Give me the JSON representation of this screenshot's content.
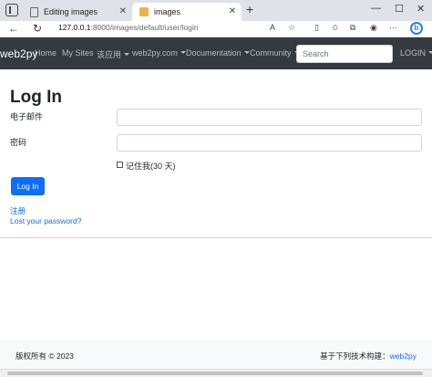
{
  "browser": {
    "tabs": [
      {
        "title": "Editing images",
        "icon": "document-icon"
      },
      {
        "title": "images",
        "icon": "folder-icon"
      }
    ],
    "new_tab": "+",
    "close": "✕",
    "url_host": "127.0.0.1",
    "url_path": ":8000/images/default/user/login",
    "read_aloud": "A",
    "win_min": "—",
    "win_max": "☐",
    "win_close": "✕"
  },
  "navbar": {
    "brand": "web2py",
    "links": [
      {
        "label": "Home"
      },
      {
        "label": "My Sites"
      },
      {
        "label": "该应用"
      },
      {
        "label": "web2py.com"
      },
      {
        "label": "Documentation"
      },
      {
        "label": "Community"
      }
    ],
    "search_placeholder": "Search",
    "login": "LOGIN",
    "bg_color": "#343a40"
  },
  "form": {
    "title": "Log In",
    "email_label": "电子邮件",
    "email_value": "",
    "password_label": "密码",
    "password_value": "",
    "remember_label": "记住我(30 天)",
    "remember_checked": false,
    "submit": "Log In",
    "register": "注册",
    "lost_password": "Lost your password?",
    "accent": "#0d6efd"
  },
  "footer": {
    "copyright": "版权所有 © 2023",
    "built_with": "基于下列技术构建：",
    "built_link": "web2py"
  }
}
